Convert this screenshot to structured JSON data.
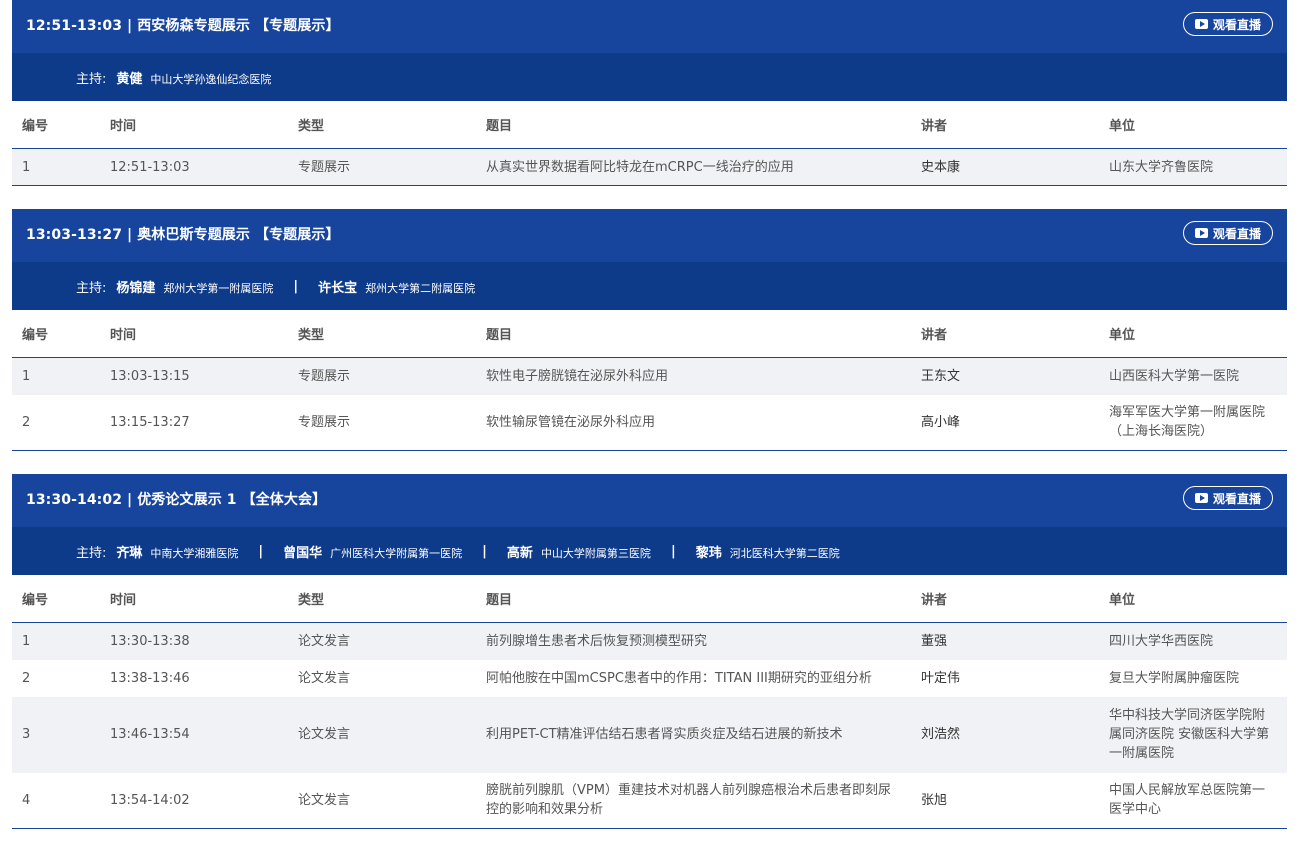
{
  "columns": [
    "编号",
    "时间",
    "类型",
    "题目",
    "讲者",
    "单位"
  ],
  "live_label": "观看直播",
  "host_label": "主持:",
  "sessions": [
    {
      "title": "12:51-13:03 | 西安杨森专题展示 【专题展示】",
      "hosts": [
        {
          "name": "黄健",
          "inst": "中山大学孙逸仙纪念医院"
        }
      ],
      "rows": [
        {
          "no": "1",
          "time": "12:51-13:03",
          "type": "专题展示",
          "topic": "从真实世界数据看阿比特龙在mCRPC一线治疗的应用",
          "speaker": "史本康",
          "unit": "山东大学齐鲁医院",
          "h": 37
        }
      ]
    },
    {
      "title": "13:03-13:27 | 奥林巴斯专题展示 【专题展示】",
      "hosts": [
        {
          "name": "杨锦建",
          "inst": "郑州大学第一附属医院"
        },
        {
          "name": "许长宝",
          "inst": "郑州大学第二附属医院"
        }
      ],
      "rows": [
        {
          "no": "1",
          "time": "13:03-13:15",
          "type": "专题展示",
          "topic": "软性电子膀胱镜在泌尿外科应用",
          "speaker": "王东文",
          "unit": "山西医科大学第一医院",
          "h": 37
        },
        {
          "no": "2",
          "time": "13:15-13:27",
          "type": "专题展示",
          "topic": "软性输尿管镜在泌尿外科应用",
          "speaker": "高小峰",
          "unit": "海军军医大学第一附属医院（上海长海医院）",
          "h": 56
        }
      ]
    },
    {
      "title": "13:30-14:02 | 优秀论文展示 1 【全体大会】",
      "hosts": [
        {
          "name": "齐琳",
          "inst": "中南大学湘雅医院"
        },
        {
          "name": "曾国华",
          "inst": "广州医科大学附属第一医院"
        },
        {
          "name": "高新",
          "inst": "中山大学附属第三医院"
        },
        {
          "name": "黎玮",
          "inst": "河北医科大学第二医院"
        }
      ],
      "rows": [
        {
          "no": "1",
          "time": "13:30-13:38",
          "type": "论文发言",
          "topic": "前列腺增生患者术后恢复预测模型研究",
          "speaker": "董强",
          "unit": "四川大学华西医院",
          "h": 37
        },
        {
          "no": "2",
          "time": "13:38-13:46",
          "type": "论文发言",
          "topic": "阿帕他胺在中国mCSPC患者中的作用：TITAN III期研究的亚组分析",
          "speaker": "叶定伟",
          "unit": "复旦大学附属肿瘤医院",
          "h": 37
        },
        {
          "no": "3",
          "time": "13:46-13:54",
          "type": "论文发言",
          "topic": "利用PET-CT精准评估结石患者肾实质炎症及结石进展的新技术",
          "speaker": "刘浩然",
          "unit": "华中科技大学同济医学院附属同济医院 安徽医科大学第一附属医院",
          "h": 76
        },
        {
          "no": "4",
          "time": "13:54-14:02",
          "type": "论文发言",
          "topic": "膀胱前列腺肌（VPM）重建技术对机器人前列腺癌根治术后患者即刻尿控的影响和效果分析",
          "speaker": "张旭",
          "unit": "中国人民解放军总医院第一医学中心",
          "h": 56
        }
      ]
    }
  ]
}
